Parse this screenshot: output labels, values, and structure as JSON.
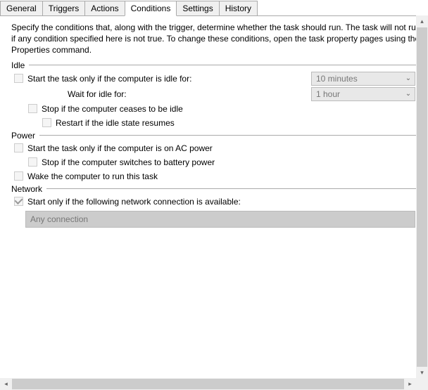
{
  "tabs": {
    "general": "General",
    "triggers": "Triggers",
    "actions": "Actions",
    "conditions": "Conditions",
    "settings": "Settings",
    "history": "History"
  },
  "description": "Specify the conditions that, along with the trigger, determine whether the task should run.  The task will not run if any condition specified here is not true.  To change these conditions, open the task property pages using the Properties command.",
  "groups": {
    "idle": {
      "label": "Idle",
      "start_if_idle": "Start the task only if the computer is idle for:",
      "idle_duration": "10 minutes",
      "wait_label": "Wait for idle for:",
      "wait_duration": "1 hour",
      "stop_if_not_idle": "Stop if the computer ceases to be idle",
      "restart_if_resumes": "Restart if the idle state resumes"
    },
    "power": {
      "label": "Power",
      "on_ac": "Start the task only if the computer is on AC power",
      "stop_on_battery": "Stop if the computer switches to battery power",
      "wake": "Wake the computer to run this task"
    },
    "network": {
      "label": "Network",
      "start_if_network": "Start only if the following network connection is available:",
      "connection": "Any connection"
    }
  }
}
